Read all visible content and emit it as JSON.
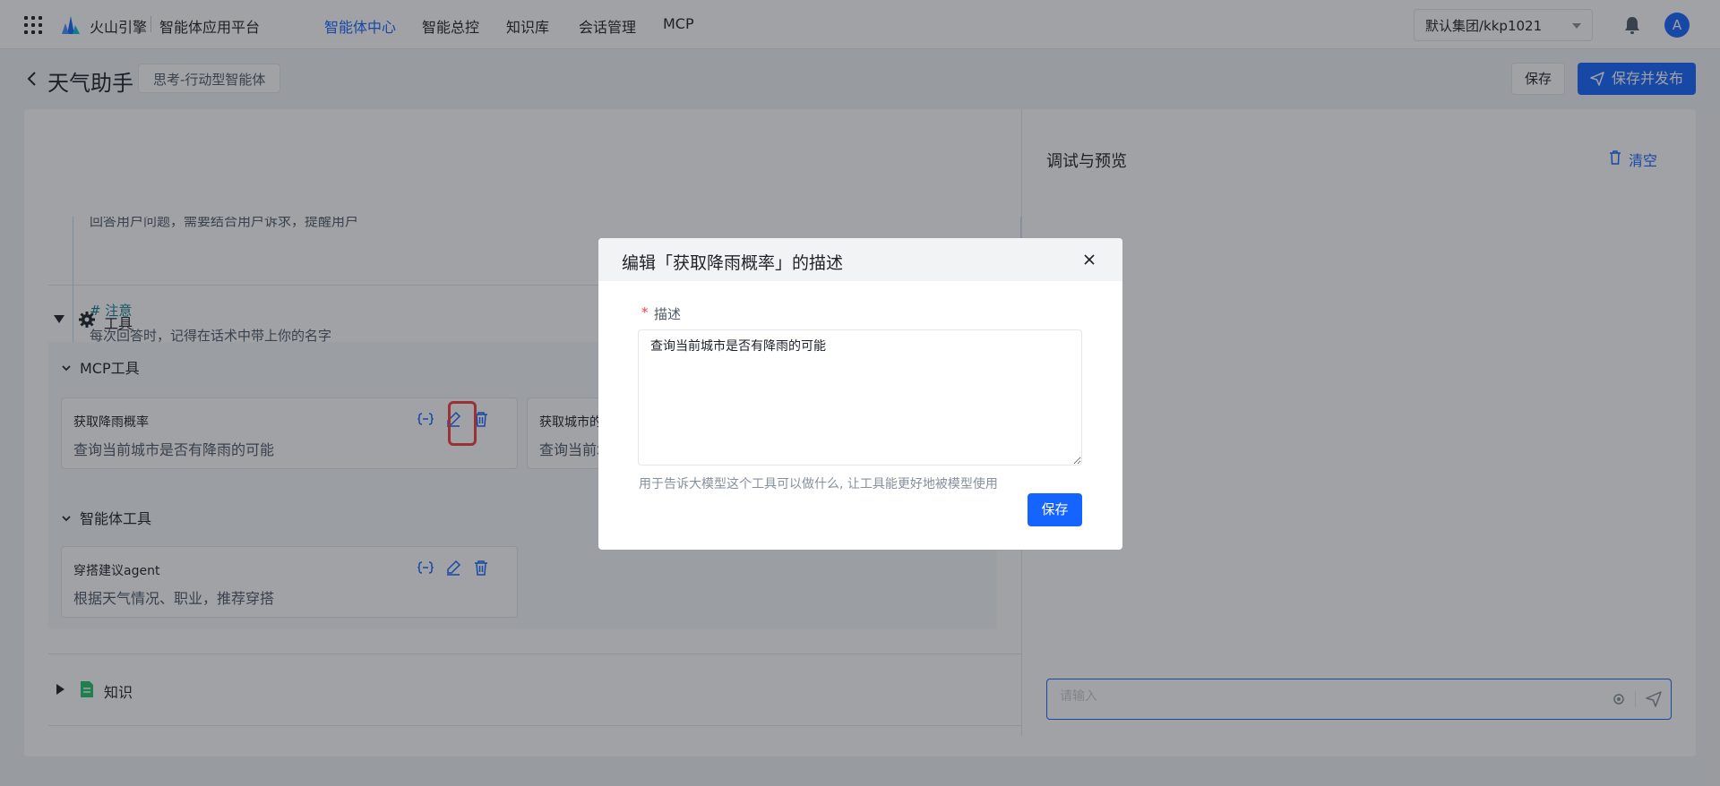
{
  "topbar": {
    "brand": "火山引擎",
    "platform": "智能体应用平台",
    "nav": [
      "智能体中心",
      "智能总控",
      "知识库",
      "会话管理",
      "MCP"
    ],
    "org": "默认集团/kkp1021",
    "avatar_letter": "A"
  },
  "header": {
    "title": "天气助手",
    "type_tag": "思考-行动型智能体",
    "save_label": "保存",
    "publish_label": "保存并发布"
  },
  "prompt": {
    "clipped_line": "回答用户问题，需要结合用户诉求，提醒用户",
    "heading": "# 注意",
    "body": "每次回答时，记得在话术中带上你的名字"
  },
  "tools": {
    "section_title": "工具",
    "mcp_title": "MCP工具",
    "mcp_cards": [
      {
        "name": "获取降雨概率",
        "desc": "查询当前城市是否有降雨的可能"
      },
      {
        "name": "获取城市的",
        "desc": "查询当前城"
      }
    ],
    "agent_title": "智能体工具",
    "agent_cards": [
      {
        "name": "穿搭建议agent",
        "desc": "根据天气情况、职业，推荐穿搭"
      }
    ]
  },
  "knowledge": {
    "title": "知识"
  },
  "preview": {
    "title": "调试与预览",
    "clear_label": "清空",
    "input_placeholder": "请输入"
  },
  "modal": {
    "title": "编辑「获取降雨概率」的描述",
    "required_mark": "*",
    "field_label": "描述",
    "value": "查询当前城市是否有降雨的可能",
    "help": "用于告诉大模型这个工具可以做什么, 让工具能更好地被模型使用",
    "save_label": "保存"
  },
  "colors": {
    "primary": "#1664ff",
    "highlight": "#f53f3f"
  }
}
